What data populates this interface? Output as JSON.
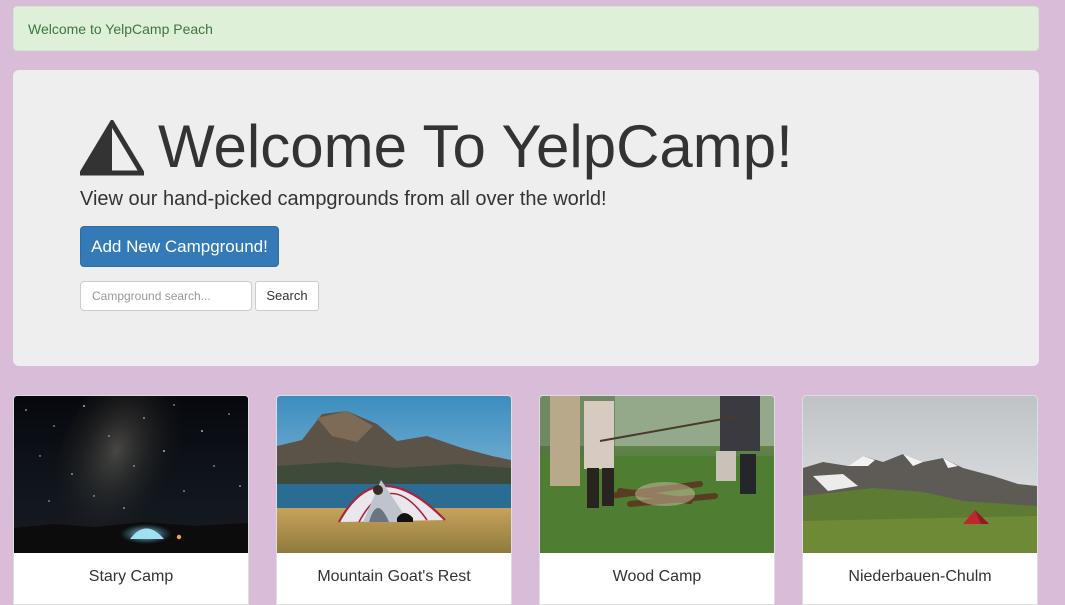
{
  "flash": {
    "message": "Welcome to YelpCamp Peach"
  },
  "jumbotron": {
    "icon": "tent-icon",
    "title": "Welcome To YelpCamp!",
    "subtitle": "View our hand-picked campgrounds from all over the world!",
    "add_button_label": "Add New Campground!",
    "search_placeholder": "Campground search...",
    "search_value": "",
    "search_button_label": "Search"
  },
  "campgrounds": [
    {
      "name": "Stary Camp"
    },
    {
      "name": "Mountain Goat's Rest"
    },
    {
      "name": "Wood Camp"
    },
    {
      "name": "Niederbauen-Chulm"
    }
  ],
  "colors": {
    "page_background": "#d8bcd8",
    "primary_button": "#337ab7",
    "alert_background": "#dff0d8",
    "alert_text": "#3c763d"
  }
}
